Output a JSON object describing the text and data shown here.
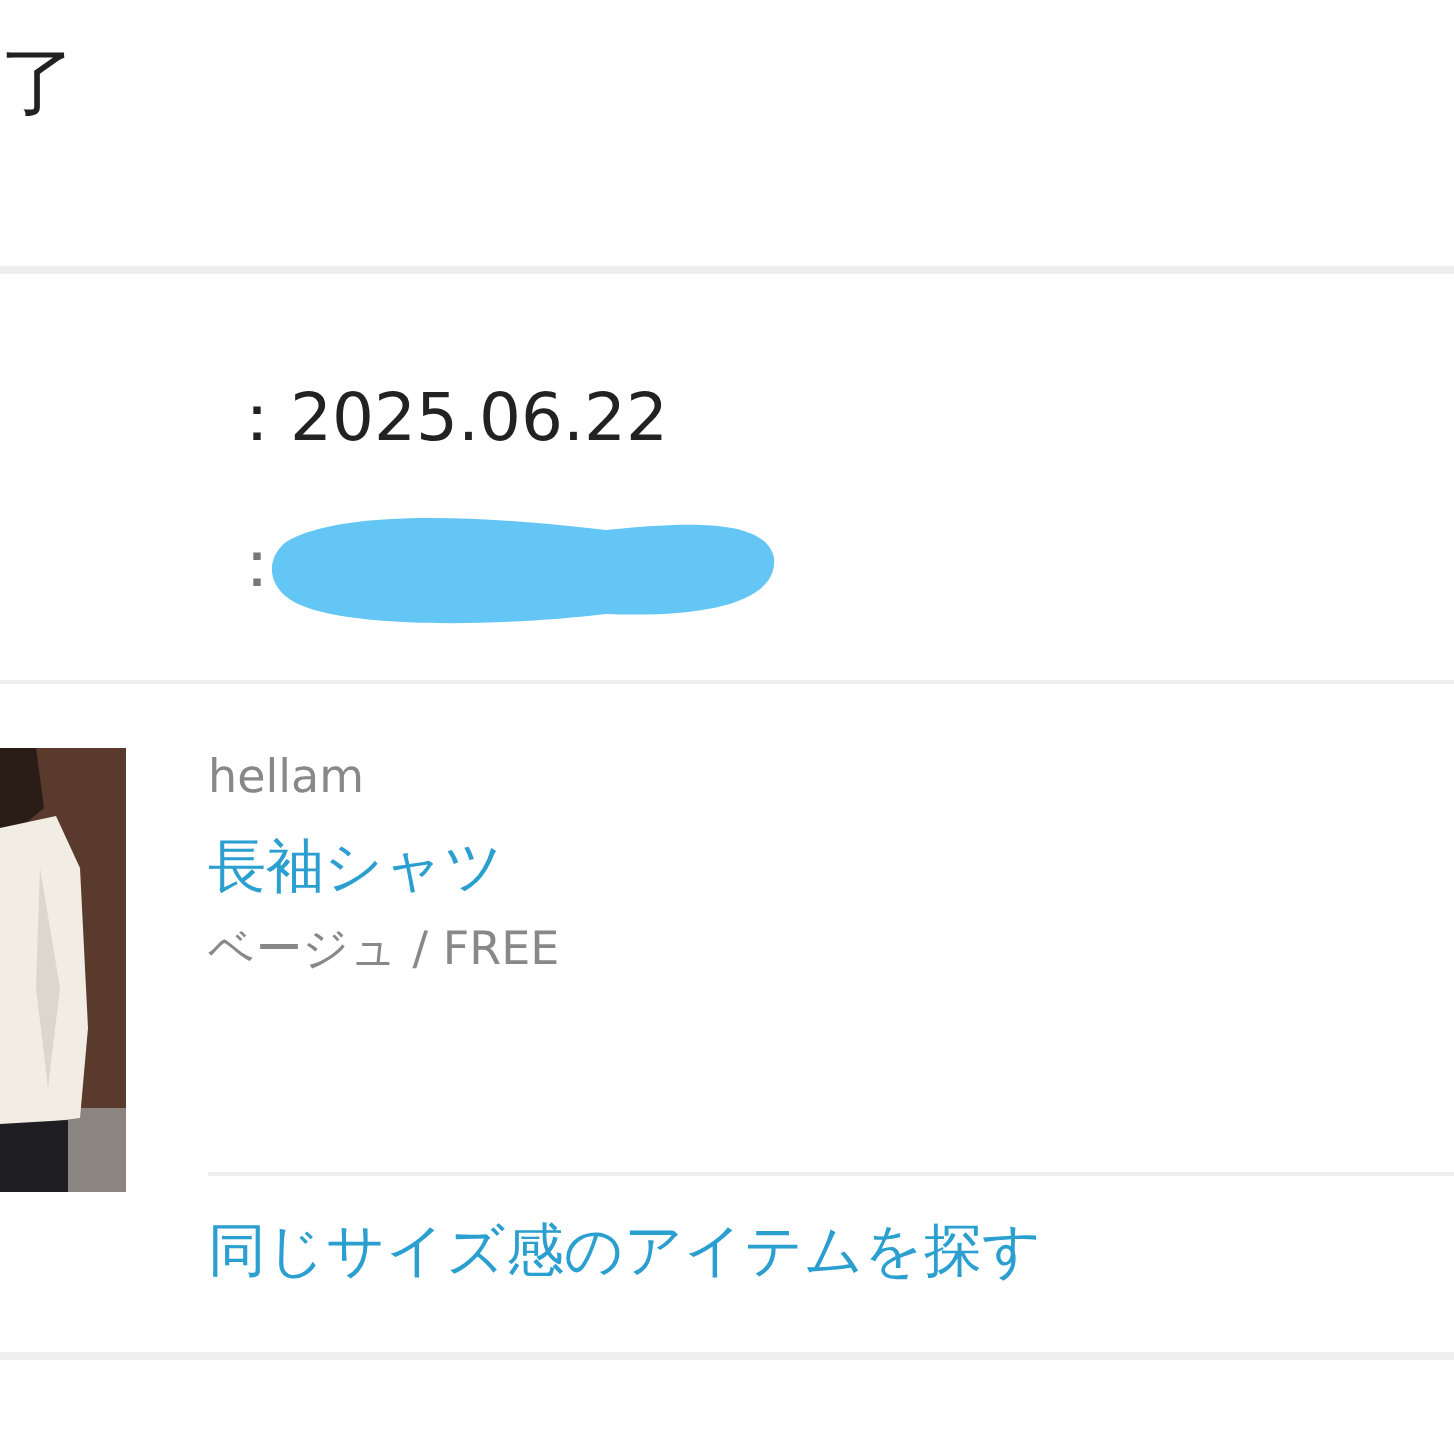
{
  "header": {
    "title": "了"
  },
  "order_info": {
    "date": "：2025.06.22",
    "redacted_prefix": "："
  },
  "product": {
    "brand": "hellam",
    "name": "長袖シャツ",
    "variant": "ベージュ / FREE",
    "link": "同じサイズ感のアイテムを探す"
  }
}
